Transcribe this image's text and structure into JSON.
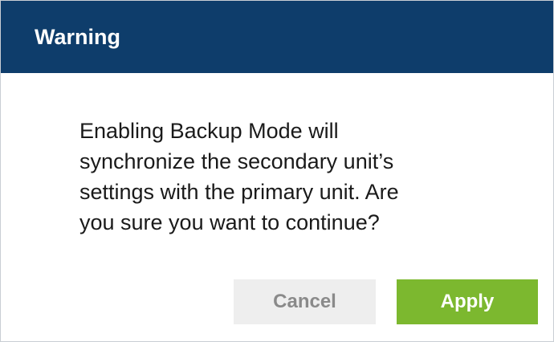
{
  "dialog": {
    "title": "Warning",
    "message_lines": [
      "Enabling Backup Mode will",
      "synchronize the secondary unit’s",
      "settings with the primary unit. Are",
      "you sure you want to continue?"
    ],
    "cancel_label": "Cancel",
    "apply_label": "Apply"
  },
  "colors": {
    "header_background": "#0e3d6b",
    "apply_button": "#7cb82f",
    "cancel_button": "#eeeeee"
  }
}
